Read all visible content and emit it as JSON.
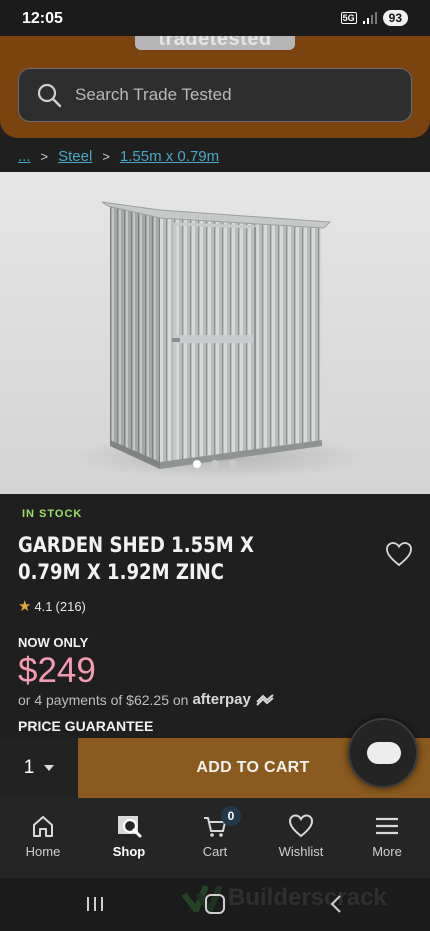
{
  "status_bar": {
    "time": "12:05",
    "network": "5G",
    "battery": "93"
  },
  "header": {
    "logo": "tradetested",
    "search": {
      "placeholder": "Search Trade Tested"
    }
  },
  "breadcrumb": {
    "ellipsis": "...",
    "items": [
      "Steel",
      "1.55m x 0.79m"
    ]
  },
  "product": {
    "stock_status": "IN STOCK",
    "title": "GARDEN SHED 1.55M X 0.79M X 1.92M ZINC",
    "rating": "4.1",
    "review_count": "(216)",
    "price_label": "NOW ONLY",
    "price": "$249",
    "installments": "or 4 payments of $62.25 on",
    "afterpay_label": "afterpay",
    "guarantee": "PRICE GUARANTEE",
    "image_count": 3,
    "active_image": 1
  },
  "cart_bar": {
    "quantity": "1",
    "add_label": "ADD TO CART"
  },
  "nav": {
    "items": [
      {
        "label": "Home",
        "icon": "home-icon"
      },
      {
        "label": "Shop",
        "icon": "shop-icon"
      },
      {
        "label": "Cart",
        "icon": "cart-icon",
        "badge": "0"
      },
      {
        "label": "Wishlist",
        "icon": "heart-icon"
      },
      {
        "label": "More",
        "icon": "menu-icon"
      }
    ],
    "active": "Shop"
  },
  "watermark": "Builderscrack",
  "colors": {
    "header_brown": "#7a4310",
    "add_to_cart": "#8a5a1e",
    "price_pink": "#f29cb4",
    "stock_green": "#9be26a",
    "link_blue": "#49a7c7"
  }
}
